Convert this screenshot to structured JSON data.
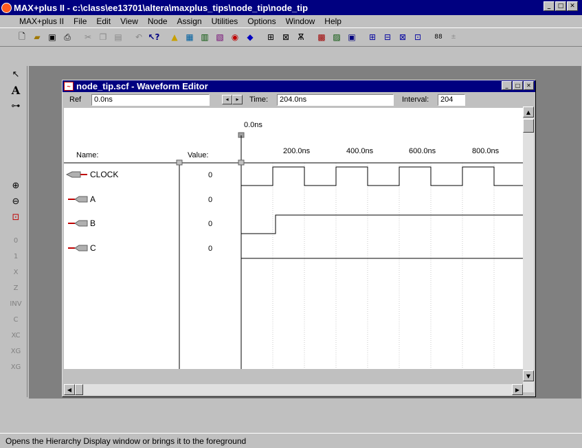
{
  "app": {
    "title": "MAX+plus II - c:\\class\\ee13701\\altera\\maxplus_tips\\node_tip\\node_tip",
    "menu": [
      "MAX+plus II",
      "File",
      "Edit",
      "View",
      "Node",
      "Assign",
      "Utilities",
      "Options",
      "Window",
      "Help"
    ]
  },
  "toolbar": {
    "buttons": [
      "new-icon",
      "open-icon",
      "save-icon",
      "print-icon",
      "cut-icon",
      "copy-icon",
      "paste-icon",
      "undo-icon",
      "help-pointer-icon",
      "hierarchy-icon",
      "floorplan-icon",
      "compiler-icon",
      "simulator-icon",
      "timing-icon",
      "programmer-icon",
      "open-scf-icon",
      "save-check-icon",
      "project-icon",
      "save-compile-icon",
      "save-simulate-icon",
      "save-all-icon",
      "grid-icon-1",
      "grid-icon-2",
      "grid-icon-3",
      "grid-icon-4",
      "numbers-icon",
      "overwrite-icon"
    ]
  },
  "palette": {
    "tools": [
      {
        "name": "selection-tool-icon",
        "glyph": "↖"
      },
      {
        "name": "text-tool-icon",
        "glyph": "A"
      },
      {
        "name": "node-tool-icon",
        "glyph": "⊶"
      },
      {
        "name": "zoom-in-icon",
        "glyph": "⊕"
      },
      {
        "name": "zoom-out-icon",
        "glyph": "⊖"
      },
      {
        "name": "fit-window-icon",
        "glyph": "⊡"
      },
      {
        "name": "force-low-icon",
        "glyph": "0"
      },
      {
        "name": "force-high-icon",
        "glyph": "1"
      },
      {
        "name": "force-x-icon",
        "glyph": "X"
      },
      {
        "name": "force-z-icon",
        "glyph": "Z"
      },
      {
        "name": "invert-icon",
        "glyph": "INV"
      },
      {
        "name": "clock-value-icon",
        "glyph": "C"
      },
      {
        "name": "count-value-icon",
        "glyph": "XC"
      },
      {
        "name": "group-value-icon",
        "glyph": "XG"
      },
      {
        "name": "overwrite-value-icon",
        "glyph": "XG"
      }
    ]
  },
  "editor": {
    "window_title": "node_tip.scf - Waveform Editor",
    "ref_label": "Ref",
    "ref_value": "0.0ns",
    "time_label": "Time:",
    "time_value": "204.0ns",
    "interval_label": "Interval:",
    "interval_value": "204",
    "marker_label": "0.0ns",
    "name_header": "Name:",
    "value_header": "Value:",
    "time_ticks": [
      "200.0ns",
      "400.0ns",
      "600.0ns",
      "800.0ns"
    ],
    "signals": [
      {
        "name": "CLOCK",
        "value": "0",
        "type": "input"
      },
      {
        "name": "A",
        "value": "0",
        "type": "input"
      },
      {
        "name": "B",
        "value": "0",
        "type": "input"
      },
      {
        "name": "C",
        "value": "0",
        "type": "output"
      }
    ]
  },
  "status": {
    "text": "Opens the Hierarchy Display window or brings it to the foreground"
  },
  "colors": {
    "titlebar": "#000080",
    "face": "#c0c0c0",
    "desktop": "#808080"
  }
}
